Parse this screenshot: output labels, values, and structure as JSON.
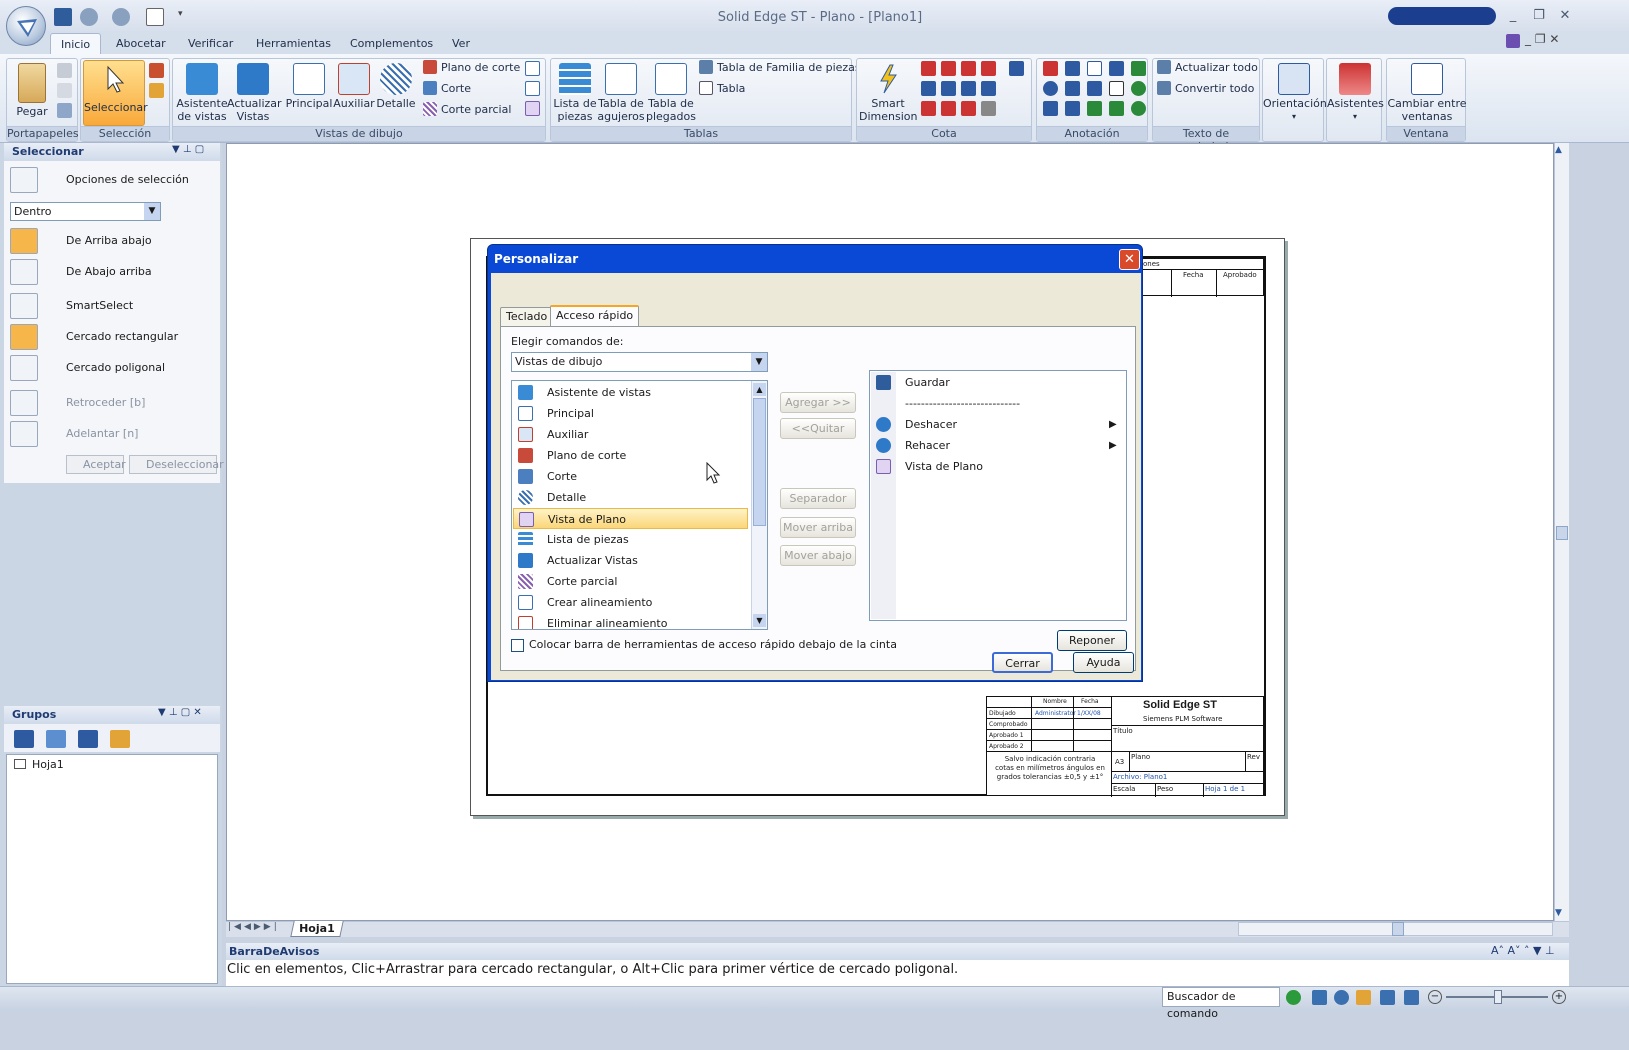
{
  "window": {
    "title": "Solid Edge ST - Plano - [Plano1]",
    "minimize": "_",
    "restore": "❐",
    "close": "✕"
  },
  "tabs": [
    {
      "label": "Inicio"
    },
    {
      "label": "Abocetar"
    },
    {
      "label": "Verificar"
    },
    {
      "label": "Herramientas"
    },
    {
      "label": "Complementos"
    },
    {
      "label": "Ver"
    }
  ],
  "ribbon": {
    "portapapeles": {
      "label": "Portapapeles",
      "pegar": "Pegar"
    },
    "seleccion": {
      "label": "Selección",
      "seleccionar": "Seleccionar"
    },
    "vistas": {
      "label": "Vistas de dibujo",
      "asistente": "Asistente de vistas",
      "actualizar": "Actualizar Vistas",
      "principal": "Principal",
      "auxiliar": "Auxiliar",
      "detalle": "Detalle",
      "plano_corte": "Plano de corte",
      "corte": "Corte",
      "corte_parcial": "Corte parcial"
    },
    "tablas": {
      "label": "Tablas",
      "lista_piezas": "Lista de piezas",
      "tabla_agujeros": "Tabla de agujeros",
      "tabla_plegados": "Tabla de plegados",
      "familia": "Tabla de Familia de piezas",
      "tabla": "Tabla"
    },
    "cota": {
      "label": "Cota",
      "smart": "Smart Dimension"
    },
    "anotacion": {
      "label": "Anotación"
    },
    "texto": {
      "label": "Texto de propiedad...",
      "actualizar_todo": "Actualizar todo",
      "convertir_todo": "Convertir todo"
    },
    "orientacion": "Orientación",
    "asistentes": "Asistentes",
    "ventana": {
      "label": "Ventana",
      "cambiar": "Cambiar entre ventanas"
    }
  },
  "seleccionar_panel": {
    "title": "Seleccionar",
    "opciones": "Opciones de selección",
    "dropdown": "Dentro",
    "items": [
      "De Arriba abajo",
      "De Abajo arriba",
      "SmartSelect",
      "Cercado rectangular",
      "Cercado poligonal"
    ],
    "retroceder": "Retroceder [b]",
    "adelantar": "Adelantar [n]",
    "aceptar": "Aceptar",
    "deseleccionar": "Deseleccionar"
  },
  "grupos_panel": {
    "title": "Grupos",
    "tree_item": "Hoja1"
  },
  "dialog": {
    "title": "Personalizar",
    "tab_teclado": "Teclado",
    "tab_acceso": "Acceso rápido",
    "elegir_label": "Elegir comandos de:",
    "elegir_value": "Vistas de dibujo",
    "commands": [
      "Asistente de vistas",
      "Principal",
      "Auxiliar",
      "Plano de corte",
      "Corte",
      "Detalle",
      "Vista de Plano",
      "Lista de piezas",
      "Actualizar Vistas",
      "Corte parcial",
      "Crear alineamiento",
      "Eliminar alineamiento"
    ],
    "selected_command": "Vista de Plano",
    "agregar": "Agregar >>",
    "quitar": "<<Quitar",
    "separador": "Separador",
    "mover_arriba": "Mover arriba",
    "mover_abajo": "Mover abajo",
    "quick_access": [
      "Guardar",
      "-----------------------------",
      "Deshacer",
      "Rehacer",
      "Vista de Plano"
    ],
    "checkbox_label": "Colocar barra de herramientas de acceso rápido debajo de la cinta",
    "reponer": "Reponer",
    "cerrar": "Cerrar",
    "ayuda": "Ayuda"
  },
  "titleblock": {
    "company": "Solid Edge ST",
    "subtitle": "Siemens PLM Software",
    "headers": [
      "Nombre",
      "Fecha"
    ],
    "rows": [
      "Dibujado",
      "Comprobado",
      "Aprobado 1",
      "Aprobado 2"
    ],
    "dibujado_nombre": "Administrator",
    "dibujado_fecha": "1/XX/08",
    "nota": "Salvo indicación contraria cotas en milímetros ángulos en grados tolerancias ±0,5 y ±1°",
    "titulo": "Título",
    "a3": "A3",
    "plano": "Plano",
    "rev": "Rev",
    "archivo": "Archivo: Plano1",
    "escala": "Escala",
    "peso": "Peso",
    "hoja": "Hoja 1 de 1",
    "rev_headers": [
      "ones",
      "Fecha",
      "Aprobado"
    ]
  },
  "sheet_tab": "Hoja1",
  "barra": {
    "title": "BarraDeAvisos",
    "message": "Clic en elementos, Clic+Arrastrar para cercado rectangular, o Alt+Clic para primer vértice de cercado poligonal."
  },
  "status": {
    "buscador": "Buscador de comando"
  }
}
